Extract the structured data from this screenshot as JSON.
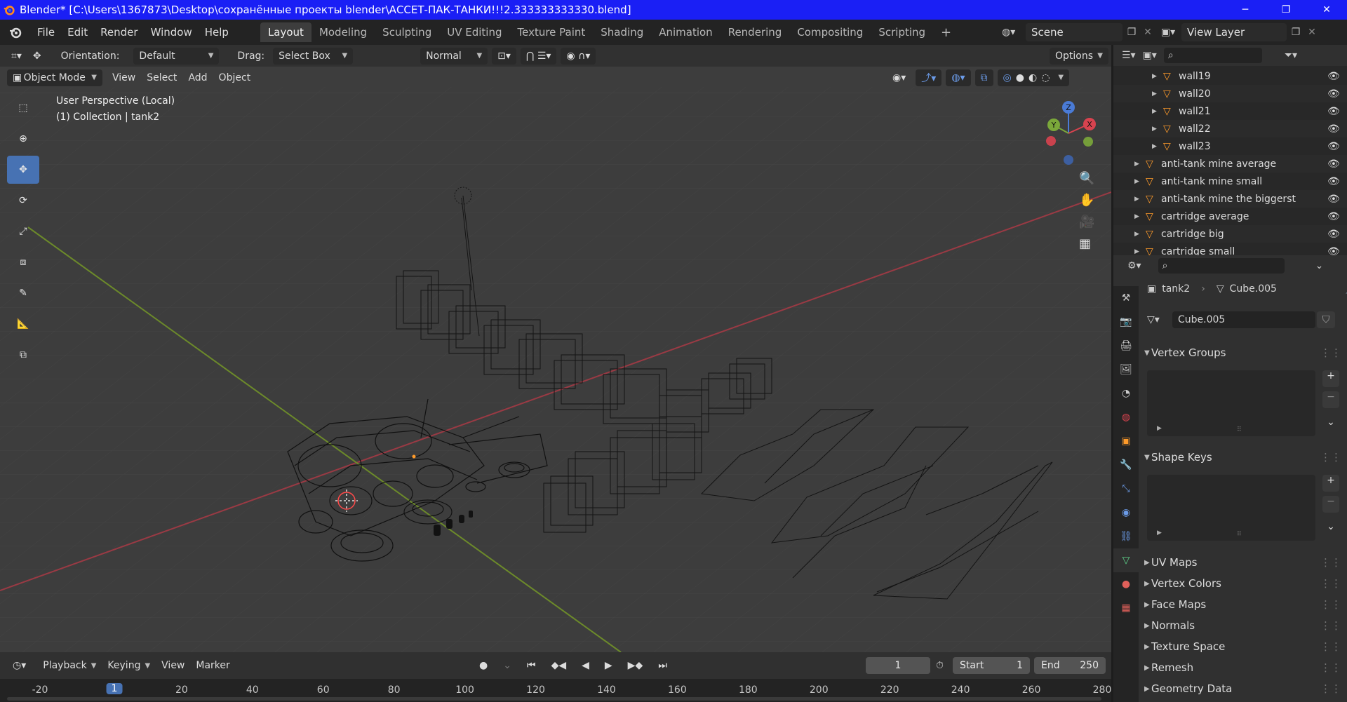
{
  "window": {
    "title": "Blender* [C:\\Users\\1367873\\Desktop\\сохранённые проекты blender\\АССЕТ-ПАК-ТАНКИ!!!2.333333333330.blend]",
    "controls": [
      "minimize-icon",
      "maximize-icon",
      "close-icon"
    ]
  },
  "menu": {
    "items": [
      "File",
      "Edit",
      "Render",
      "Window",
      "Help"
    ],
    "workspaces": [
      "Layout",
      "Modeling",
      "Sculpting",
      "UV Editing",
      "Texture Paint",
      "Shading",
      "Animation",
      "Rendering",
      "Compositing",
      "Scripting"
    ],
    "active_workspace": "Layout",
    "scene": "Scene",
    "view_layer": "View Layer"
  },
  "viewport_header": {
    "orientation_label": "Orientation:",
    "orientation_value": "Default",
    "drag_label": "Drag:",
    "drag_value": "Select Box",
    "pivot_value": "Normal",
    "options_label": "Options",
    "mode": "Object Mode",
    "menus": [
      "View",
      "Select",
      "Add",
      "Object"
    ]
  },
  "viewport": {
    "perspective_text": "User Perspective (Local)",
    "collection_text": "(1) Collection | tank2",
    "gizmo_axes": [
      "Z",
      "X",
      "Y"
    ],
    "accent_color": "#4772b3"
  },
  "outliner": {
    "rows": [
      {
        "label": "wall19",
        "indent": 2
      },
      {
        "label": "wall20",
        "indent": 2
      },
      {
        "label": "wall21",
        "indent": 2
      },
      {
        "label": "wall22",
        "indent": 2
      },
      {
        "label": "wall23",
        "indent": 2
      },
      {
        "label": "anti-tank mine average",
        "indent": 1
      },
      {
        "label": "anti-tank mine small",
        "indent": 1
      },
      {
        "label": "anti-tank mine the biggerst",
        "indent": 1
      },
      {
        "label": "cartridge average",
        "indent": 1
      },
      {
        "label": "cartridge big",
        "indent": 1
      },
      {
        "label": "cartridge small",
        "indent": 1
      }
    ]
  },
  "properties": {
    "object_name": "tank2",
    "mesh_name": "Cube.005",
    "datablock_name": "Cube.005",
    "panels_open": [
      "Vertex Groups",
      "Shape Keys"
    ],
    "panels_closed": [
      "UV Maps",
      "Vertex Colors",
      "Face Maps",
      "Normals",
      "Texture Space",
      "Remesh",
      "Geometry Data"
    ]
  },
  "timeline": {
    "menus": [
      "Playback",
      "Keying",
      "View",
      "Marker"
    ],
    "current_frame": "1",
    "start_label": "Start",
    "start_value": "1",
    "end_label": "End",
    "end_value": "250",
    "ruler_ticks": [
      "-20",
      "1",
      "20",
      "40",
      "60",
      "80",
      "100",
      "120",
      "140",
      "160",
      "180",
      "200",
      "220",
      "240",
      "260",
      "280"
    ],
    "current_tick": "1"
  }
}
